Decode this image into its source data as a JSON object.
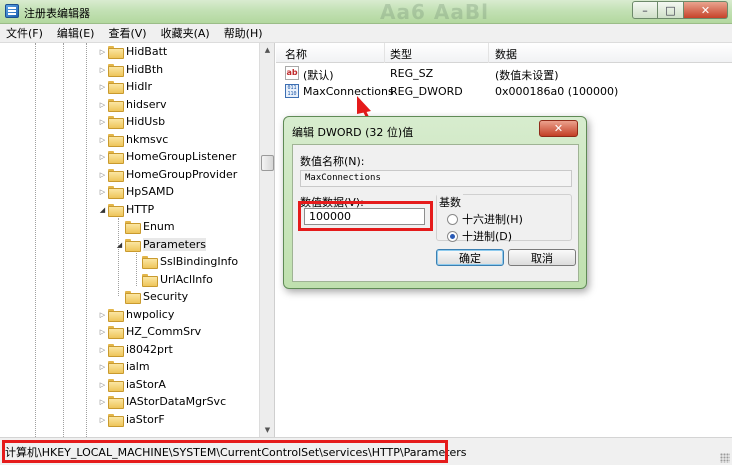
{
  "window": {
    "title": "注册表编辑器",
    "minimize": "–",
    "maximize": "□",
    "close": "✕"
  },
  "menu": [
    "文件(F)",
    "编辑(E)",
    "查看(V)",
    "收藏夹(A)",
    "帮助(H)"
  ],
  "tree": {
    "items": [
      {
        "label": "HidBatt",
        "expander": "▷"
      },
      {
        "label": "HidBth",
        "expander": "▷"
      },
      {
        "label": "HidIr",
        "expander": "▷"
      },
      {
        "label": "hidserv",
        "expander": "▷"
      },
      {
        "label": "HidUsb",
        "expander": "▷"
      },
      {
        "label": "hkmsvc",
        "expander": "▷"
      },
      {
        "label": "HomeGroupListener",
        "expander": "▷"
      },
      {
        "label": "HomeGroupProvider",
        "expander": "▷"
      },
      {
        "label": "HpSAMD",
        "expander": "▷"
      },
      {
        "label": "HTTP",
        "expander": "◢"
      },
      {
        "label": "Enum",
        "expander": ""
      },
      {
        "label": "Parameters",
        "expander": "◢"
      },
      {
        "label": "SslBindingInfo",
        "expander": ""
      },
      {
        "label": "UrlAclInfo",
        "expander": ""
      },
      {
        "label": "Security",
        "expander": ""
      },
      {
        "label": "hwpolicy",
        "expander": "▷"
      },
      {
        "label": "HZ_CommSrv",
        "expander": "▷"
      },
      {
        "label": "i8042prt",
        "expander": "▷"
      },
      {
        "label": "ialm",
        "expander": "▷"
      },
      {
        "label": "iaStorA",
        "expander": "▷"
      },
      {
        "label": "IAStorDataMgrSvc",
        "expander": "▷"
      },
      {
        "label": "iaStorF",
        "expander": "▷"
      }
    ]
  },
  "list": {
    "headers": {
      "name": "名称",
      "type": "类型",
      "data": "数据"
    },
    "rows": [
      {
        "icon": "ab",
        "name": "(默认)",
        "type": "REG_SZ",
        "data": "(数值未设置)"
      },
      {
        "icon": "011 110",
        "name": "MaxConnections",
        "type": "REG_DWORD",
        "data": "0x000186a0 (100000)"
      }
    ]
  },
  "dialog": {
    "title": "编辑 DWORD (32 位)值",
    "close": "✕",
    "name_label": "数值名称(N):",
    "name_value": "MaxConnections",
    "data_label": "数值数据(V):",
    "data_value": "100000",
    "base_label": "基数",
    "hex_label": "十六进制(H)",
    "dec_label": "十进制(D)",
    "selected_base": "十进制(D)",
    "ok": "确定",
    "cancel": "取消"
  },
  "status": {
    "path": "计算机\\HKEY_LOCAL_MACHINE\\SYSTEM\\CurrentControlSet\\services\\HTTP\\Parameters"
  },
  "background_text": "Aa6 AaBl",
  "colors": {
    "highlight_red": "#e51b1b",
    "title_green": "#c3e1b5"
  }
}
